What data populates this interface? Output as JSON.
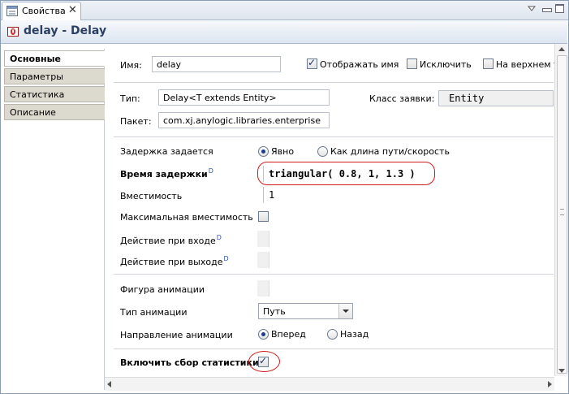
{
  "tab": {
    "label": "Свойства",
    "close": "✕"
  },
  "header": {
    "title": "delay - Delay"
  },
  "sidebar": {
    "items": [
      {
        "label": "Основные",
        "active": true
      },
      {
        "label": "Параметры"
      },
      {
        "label": "Статистика"
      },
      {
        "label": "Описание"
      }
    ]
  },
  "general": {
    "name_label": "Имя:",
    "name_value": "delay",
    "show_name_label": "Отображать имя",
    "show_name_checked": true,
    "exclude_label": "Исключить",
    "exclude_checked": false,
    "on_top_label": "На верхнем у",
    "on_top_checked": false,
    "type_label": "Тип:",
    "type_value": "Delay<T extends Entity>",
    "entity_class_label": "Класс заявки:",
    "entity_class_value": "Entity",
    "package_label": "Пакет:",
    "package_value": "com.xj.anylogic.libraries.enterprise"
  },
  "params": {
    "delay_spec_label": "Задержка задается",
    "delay_spec_options": [
      "Явно",
      "Как длина пути/скорость"
    ],
    "delay_spec_selected": 0,
    "delay_time_label": "Время задержки",
    "dyn_marker": "D",
    "delay_time_value": "triangular( 0.8, 1, 1.3 )",
    "capacity_label": "Вместимость",
    "capacity_value": "1",
    "max_capacity_label": "Максимальная вместимость",
    "max_capacity_checked": false,
    "on_enter_label": "Действие при входе",
    "on_exit_label": "Действие при выходе",
    "anim_shape_label": "Фигура анимации",
    "anim_type_label": "Тип анимации",
    "anim_type_value": "Путь",
    "anim_dir_label": "Направление анимации",
    "anim_dir_options": [
      "Вперед",
      "Назад"
    ],
    "anim_dir_selected": 0,
    "stats_label": "Включить сбор статистики",
    "stats_checked": true
  },
  "colors": {
    "highlight": "#d21a1a",
    "header_text": "#2a3f63"
  }
}
